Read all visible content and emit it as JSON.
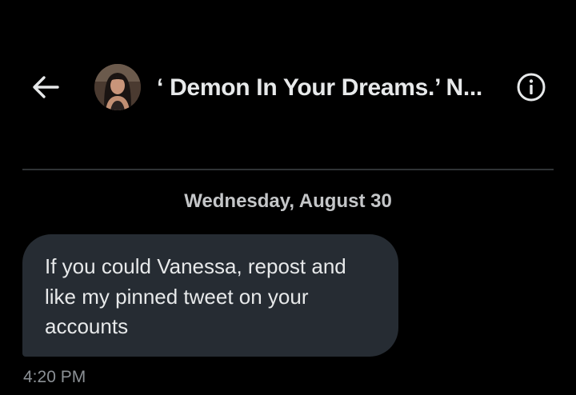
{
  "header": {
    "back_icon": "arrow-left-icon",
    "avatar_icon": "user-avatar",
    "title": "‘ Demon In Your Dreams.’ N...",
    "info_icon": "info-circle-icon"
  },
  "conversation": {
    "date_separator": "Wednesday, August 30",
    "messages": [
      {
        "text": "If you could Vanessa, repost and like my pinned tweet on your accounts",
        "time": "4:20 PM"
      }
    ]
  },
  "colors": {
    "background": "#000000",
    "bubble": "#262c33",
    "text": "#e7e9ea",
    "muted_text": "#8b9095",
    "divider": "#2f3336"
  }
}
